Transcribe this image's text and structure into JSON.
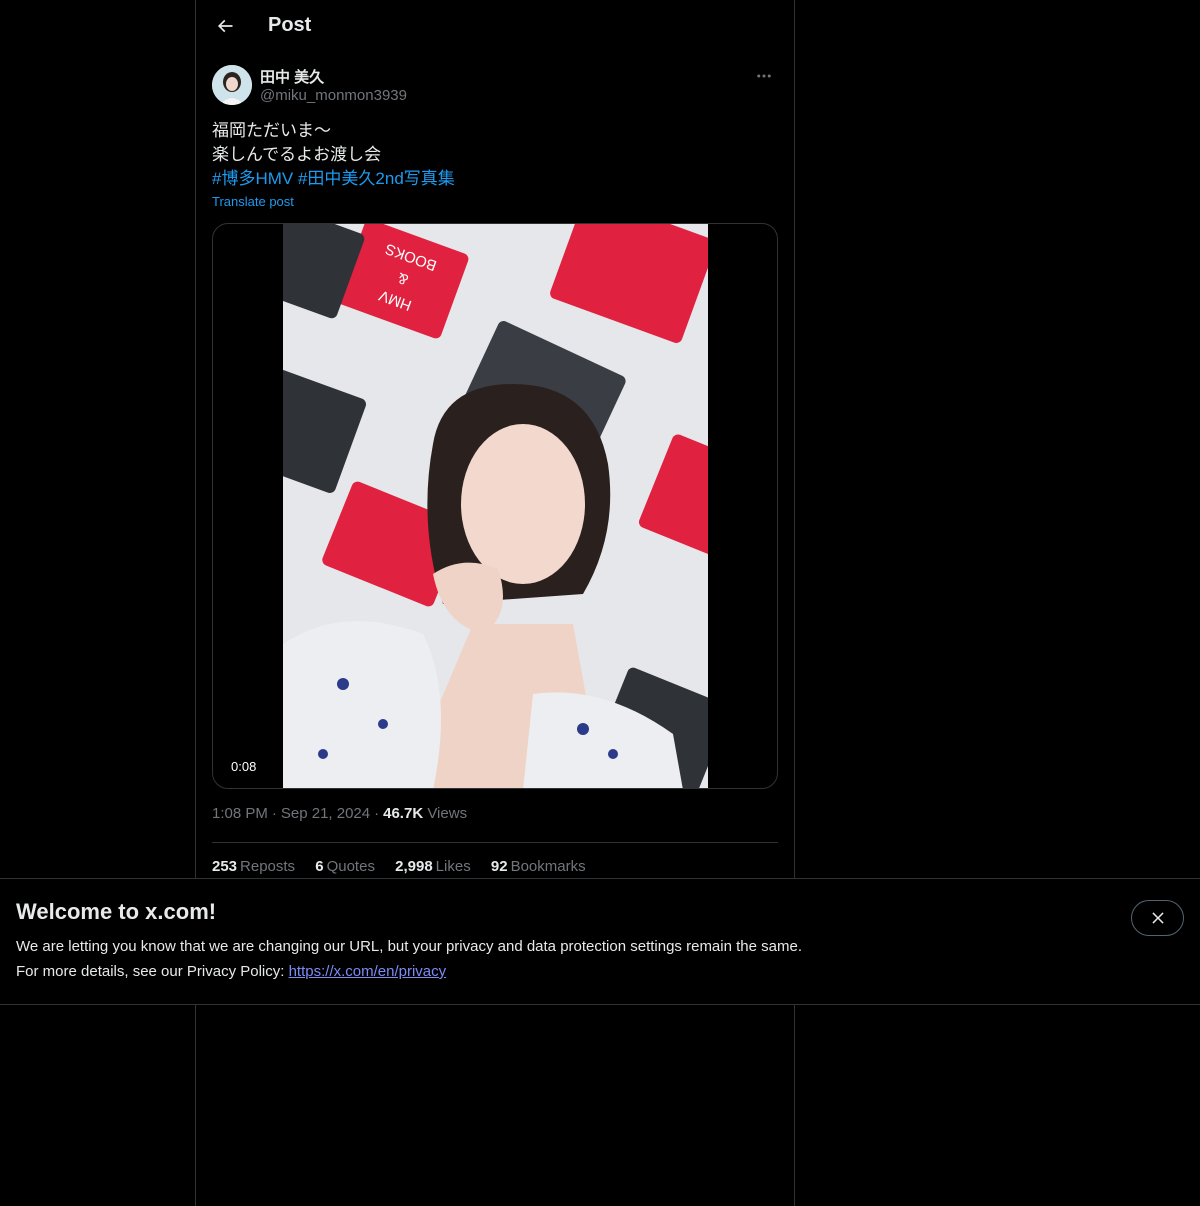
{
  "header": {
    "title": "Post"
  },
  "author": {
    "name": "田中 美久",
    "handle": "@miku_monmon3939"
  },
  "tweet": {
    "lines": [
      "福岡ただいま〜",
      "楽しんでるよお渡し会"
    ],
    "hashtags": [
      "#博多HMV",
      "#田中美久2nd写真集"
    ],
    "translate_label": "Translate post"
  },
  "media": {
    "duration": "0:08",
    "sign_text": [
      "HMV",
      "&",
      "BOOKS"
    ]
  },
  "meta": {
    "time": "1:08 PM",
    "date": "Sep 21, 2024",
    "views_count": "46.7K",
    "views_label": "Views"
  },
  "stats": {
    "reposts": {
      "count": "253",
      "label": "Reposts"
    },
    "quotes": {
      "count": "6",
      "label": "Quotes"
    },
    "likes": {
      "count": "2,998",
      "label": "Likes"
    },
    "bookmarks": {
      "count": "92",
      "label": "Bookmarks"
    }
  },
  "banner": {
    "title": "Welcome to x.com!",
    "line1": "We are letting you know that we are changing our URL, but your privacy and data protection settings remain the same.",
    "line2_prefix": "For more details, see our Privacy Policy: ",
    "link_text": "https://x.com/en/privacy"
  },
  "colors": {
    "background": "#000000",
    "link": "#1d9bf0",
    "muted": "#71767b",
    "divider": "#2f3336"
  }
}
